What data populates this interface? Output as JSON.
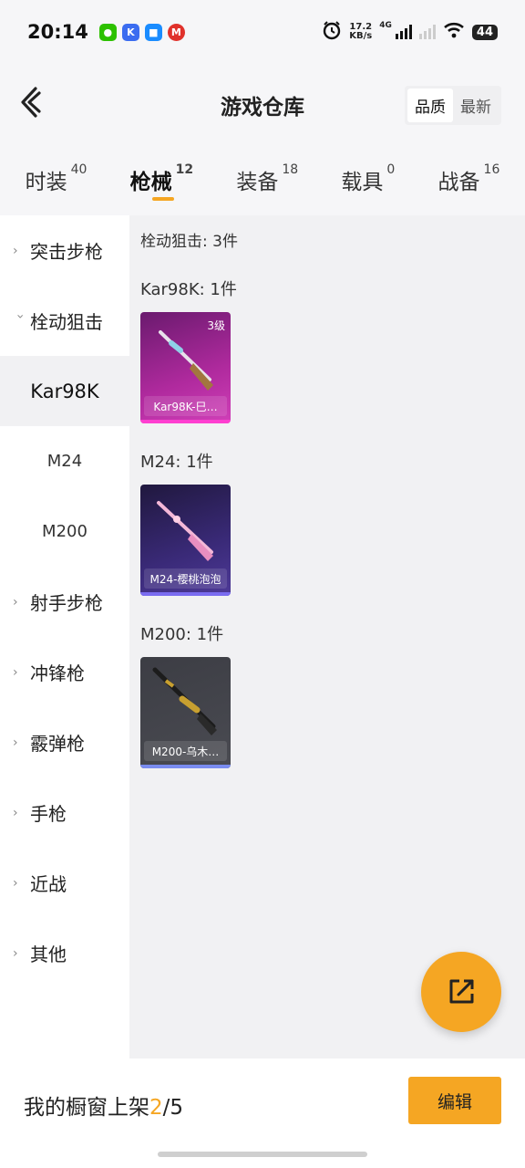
{
  "status_bar": {
    "time": "20:14",
    "net_speed_value": "17.2",
    "net_speed_unit": "KB/s",
    "network_type": "4G",
    "battery": "44"
  },
  "header": {
    "title": "游戏仓库",
    "sort_quality": "品质",
    "sort_newest": "最新"
  },
  "tabs": [
    {
      "label": "时装",
      "count": "40"
    },
    {
      "label": "枪械",
      "count": "12"
    },
    {
      "label": "装备",
      "count": "18"
    },
    {
      "label": "载具",
      "count": "0"
    },
    {
      "label": "战备",
      "count": "16"
    }
  ],
  "sidebar": {
    "items": [
      {
        "label": "突击步枪"
      },
      {
        "label": "栓动狙击"
      },
      {
        "label": "Kar98K"
      },
      {
        "label": "M24"
      },
      {
        "label": "M200"
      },
      {
        "label": "射手步枪"
      },
      {
        "label": "冲锋枪"
      },
      {
        "label": "霰弹枪"
      },
      {
        "label": "手枪"
      },
      {
        "label": "近战"
      },
      {
        "label": "其他"
      }
    ]
  },
  "content": {
    "group_title": "栓动狙击: 3件",
    "sections": [
      {
        "title": "Kar98K: 1件",
        "item_name": "Kar98K-巳…",
        "level": "3级"
      },
      {
        "title": "M24: 1件",
        "item_name": "M24-樱桃泡泡"
      },
      {
        "title": "M200: 1件",
        "item_name": "M200-乌木…"
      }
    ]
  },
  "bottom_bar": {
    "label_prefix": "我的橱窗上架",
    "current": "2",
    "total": "/5",
    "edit_button": "编辑"
  },
  "colors": {
    "accent": "#f5a623",
    "kar98k_card": "#c02aa8",
    "m24_card": "#3a2a78",
    "m200_card": "#4a4b52"
  }
}
